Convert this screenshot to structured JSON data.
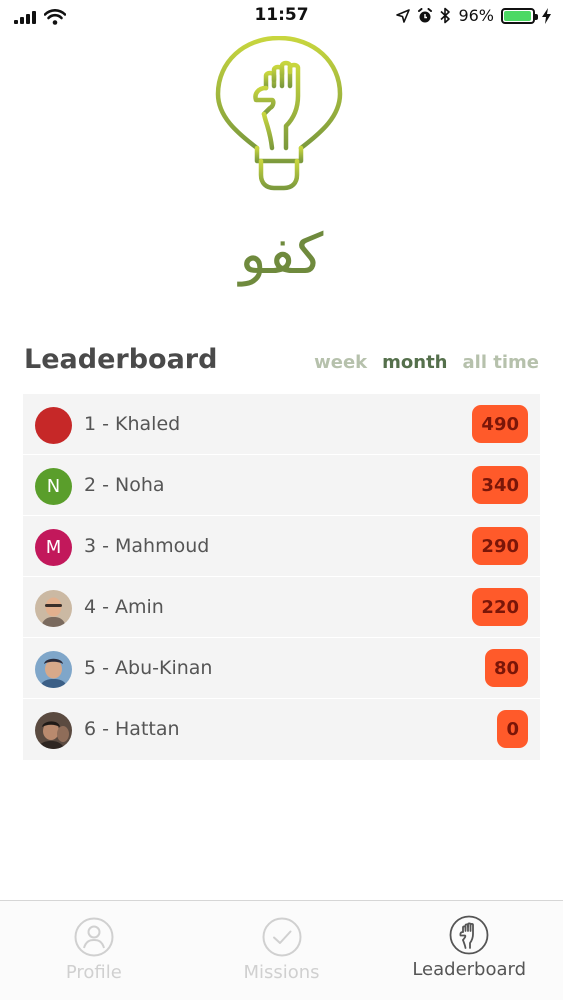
{
  "status_bar": {
    "time": "11:57",
    "battery_percent": "96%",
    "battery_level": 0.96,
    "icons": [
      "signal-icon",
      "wifi-icon",
      "location-icon",
      "alarm-icon",
      "bluetooth-icon",
      "battery-icon",
      "charging-icon"
    ]
  },
  "brand": {
    "logo_icon": "fist-lightbulb-icon",
    "name": "كفو",
    "color": "#6f8a3d"
  },
  "leaderboard": {
    "title": "Leaderboard",
    "filters": [
      {
        "label": "week",
        "active": false
      },
      {
        "label": "month",
        "active": true
      },
      {
        "label": "all time",
        "active": false
      }
    ],
    "rows": [
      {
        "name": "1 - Khaled",
        "score": "490",
        "avatar_letter": "",
        "avatar_color": "#c62828"
      },
      {
        "name": "2 - Noha",
        "score": "340",
        "avatar_letter": "N",
        "avatar_color": "#5a9e2b"
      },
      {
        "name": "3 - Mahmoud",
        "score": "290",
        "avatar_letter": "M",
        "avatar_color": "#c2185b"
      },
      {
        "name": "4 - Amin",
        "score": "220",
        "avatar_letter": "",
        "avatar_color": "#b99a7c"
      },
      {
        "name": "5 - Abu-Kinan",
        "score": "80",
        "avatar_letter": "",
        "avatar_color": "#6a8fb0"
      },
      {
        "name": "6 - Hattan",
        "score": "0",
        "avatar_letter": "",
        "avatar_color": "#6b5a4e"
      }
    ],
    "score_color": "#ff5a2a"
  },
  "tabs": [
    {
      "label": "Profile",
      "icon": "user-icon",
      "active": false
    },
    {
      "label": "Missions",
      "icon": "checkmark-circle-icon",
      "active": false
    },
    {
      "label": "Leaderboard",
      "icon": "fist-icon",
      "active": true
    }
  ]
}
